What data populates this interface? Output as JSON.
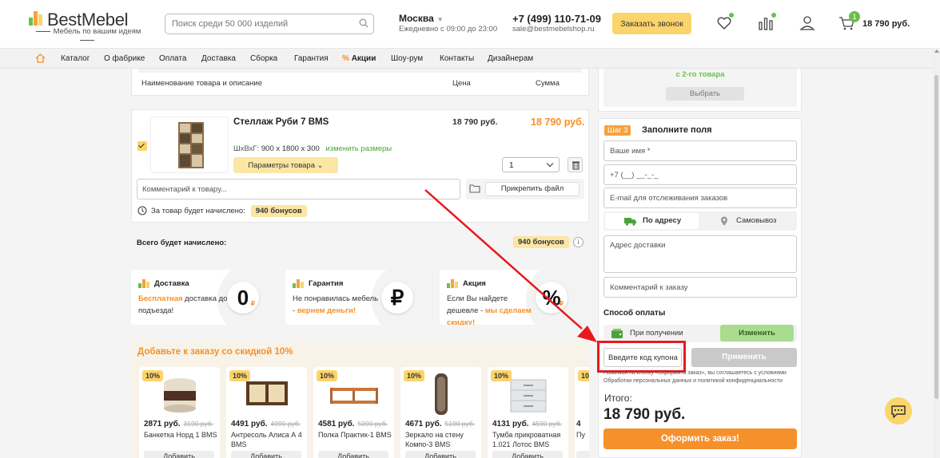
{
  "header": {
    "logo_text": "BestMebel",
    "logo_sub": "Мебель по вашим идеям",
    "search_placeholder": "Поиск среди 50 000 изделий",
    "city": "Москва",
    "hours": "Ежедневно с 09:00 до 23:00",
    "phone": "+7 (499) 110-71-09",
    "email": "sale@bestmebelshop.ru",
    "callback_label": "Заказать звонок",
    "cart_count": "1",
    "cart_total": "18 790 руб."
  },
  "nav": {
    "items": [
      "Каталог",
      "О фабрике",
      "Оплата",
      "Доставка",
      "Сборка",
      "Гарантия",
      "Акции",
      "Шоу-рум",
      "Контакты",
      "Дизайнерам"
    ],
    "promo_prefix": "%"
  },
  "cart_table": {
    "col_name": "Наименование товара и описание",
    "col_price": "Цена",
    "col_sum": "Сумма"
  },
  "product": {
    "title": "Стеллаж Руби 7 BMS",
    "price": "18 790 руб.",
    "sum": "18 790 руб.",
    "dims_label": "ШхВхГ:",
    "dims_value": "900 х 1800 х 300",
    "change_size": "изменить размеры",
    "params_label": "Параметры товара",
    "qty": "1",
    "comment_placeholder": "Комментарий к товару...",
    "attach_label": "Прикрепить файл",
    "bonus_text": "За товар будет начислено:",
    "bonus_value": "940 бонусов"
  },
  "total_bonus": {
    "label": "Всего будет начислено:",
    "value": "940 бонусов",
    "info": "i"
  },
  "features": [
    {
      "title": "Доставка",
      "text_hl": "Бесплатная",
      "text": " доставка до подъезда!",
      "badge": "0",
      "badge_sup": "₽"
    },
    {
      "title": "Гарантия",
      "text": "Не понравилась мебель - ",
      "text_hl": "вернем деньги!",
      "badge": "₽",
      "badge_sup": ""
    },
    {
      "title": "Акция",
      "text": "Если Вы найдете дешевле - ",
      "text_hl": "мы сделаем скидку!",
      "badge": "%",
      "badge_sup": "₽"
    }
  ],
  "upsell": {
    "title": "Добавьте к заказу со скидкой 10%",
    "add_label": "Добавить",
    "items": [
      {
        "disc": "10%",
        "price": "2871 руб.",
        "old": "3190 руб.",
        "name": "Банкетка Норд 1 BMS"
      },
      {
        "disc": "10%",
        "price": "4491 руб.",
        "old": "4990 руб.",
        "name": "Антресоль Алиса А 4 BMS"
      },
      {
        "disc": "10%",
        "price": "4581 руб.",
        "old": "5090 руб.",
        "name": "Полка Практик-1 BMS"
      },
      {
        "disc": "10%",
        "price": "4671 руб.",
        "old": "5190 руб.",
        "name": "Зеркало на стену Компо-3 BMS"
      },
      {
        "disc": "10%",
        "price": "4131 руб.",
        "old": "4590 руб.",
        "name": "Тумба прикроватная 1.021 Лотос BMS"
      },
      {
        "disc": "10%",
        "price": "4",
        "old": "",
        "name": "Пу"
      }
    ]
  },
  "right_top": {
    "green_text": "с 2-го товара",
    "button": "Выбрать"
  },
  "form": {
    "step": "Шаг 3",
    "title": "Заполните поля",
    "name_placeholder": "Ваше имя *",
    "phone_placeholder": "+7 (__) __-_-_",
    "email_placeholder": "E-mail для отслеживания заказов",
    "delivery_address": "По адресу",
    "delivery_pickup": "Самовывоз",
    "address_placeholder": "Адрес доставки",
    "order_comment_placeholder": "Комментарий к заказу",
    "payment_title": "Способ оплаты",
    "payment_method": "При получении",
    "change_label": "Изменить",
    "coupon_placeholder": "Введите код купона",
    "apply_label": "Применить",
    "legal": "Нажимая на кнопку «Оформить заказ», вы соглашаетесь с условиями Обработки персональных данных и политикой конфиденциальности",
    "total_label": "Итого:",
    "total_value": "18 790 руб.",
    "order_button": "Оформить заказ!"
  },
  "colors": {
    "accent": "#f5902a",
    "yellow": "#fbd46b",
    "green": "#6abf4b",
    "red_annotation": "#e8191d"
  }
}
